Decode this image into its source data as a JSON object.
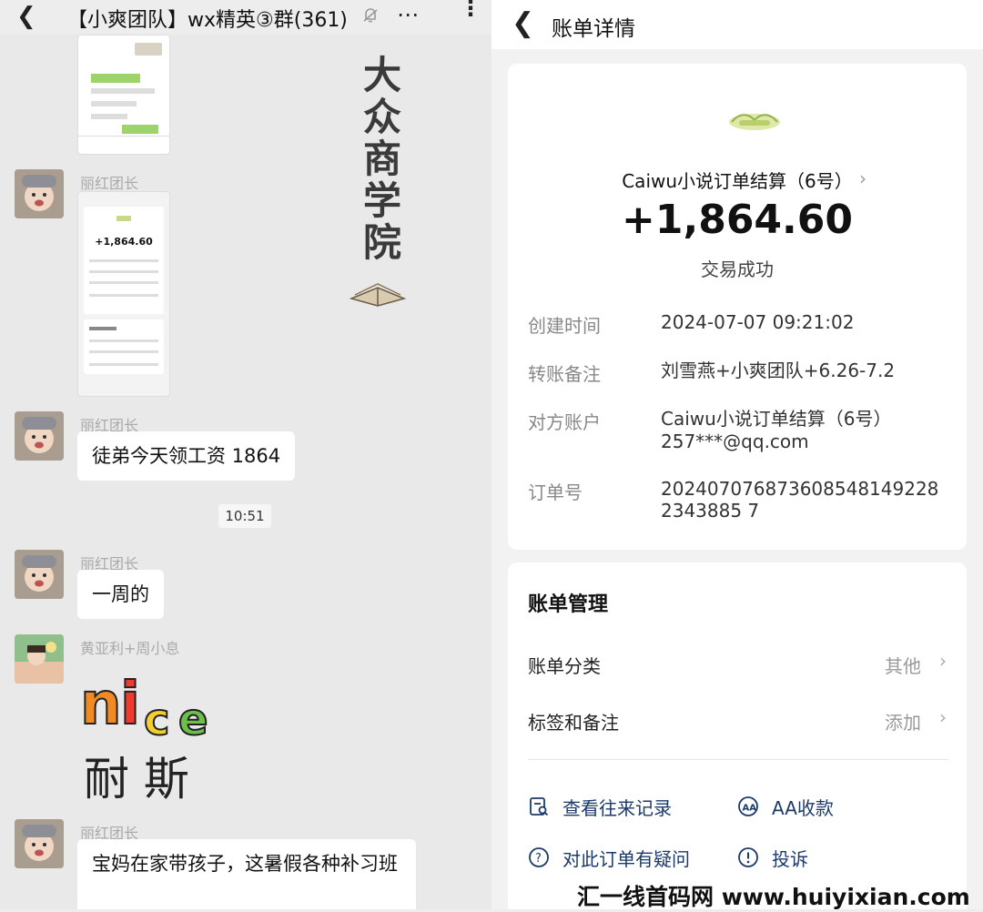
{
  "chat": {
    "title": "【小爽团队】wx精英③群(361)",
    "watermark": "大众商学院",
    "messages": [
      {
        "sender": "丽红团长",
        "text": "徒弟今天领工资 1864"
      },
      {
        "sender": "丽红团长",
        "text": "一周的"
      },
      {
        "sender": "黄亚利+周小息",
        "sticker_text": "nice 耐斯"
      },
      {
        "sender": "丽红团长",
        "text": "宝妈在家带孩子，这暑假各种补习班"
      }
    ],
    "thumb_sender": "丽红团长",
    "timestamp": "10:51",
    "thumb_amount": "+1,864.60"
  },
  "bill": {
    "title": "账单详情",
    "merchant": "Caiwu小说订单结算（6号）",
    "amount": "+1,864.60",
    "status": "交易成功",
    "details": [
      {
        "label": "创建时间",
        "value": "2024-07-07 09:21:02"
      },
      {
        "label": "转账备注",
        "value": "刘雪燕+小爽团队+6.26-7.2"
      },
      {
        "label": "对方账户",
        "value": "Caiwu小说订单结算（6号）",
        "value2": "257***@qq.com"
      },
      {
        "label": "订单号",
        "value": "2024070768736085481492282343885 7"
      }
    ],
    "management": {
      "title": "账单管理",
      "items": [
        {
          "label": "账单分类",
          "value": "其他"
        },
        {
          "label": "标签和备注",
          "value": "添加"
        }
      ]
    },
    "actions": [
      {
        "label": "查看往来记录",
        "icon": "records-icon"
      },
      {
        "label": "AA收款",
        "icon": "aa-icon"
      },
      {
        "label": "对此订单有疑问",
        "icon": "question-icon"
      },
      {
        "label": "投诉",
        "icon": "warning-icon"
      }
    ]
  },
  "site_watermark": "汇一线首码网 www.huiyixian.com"
}
